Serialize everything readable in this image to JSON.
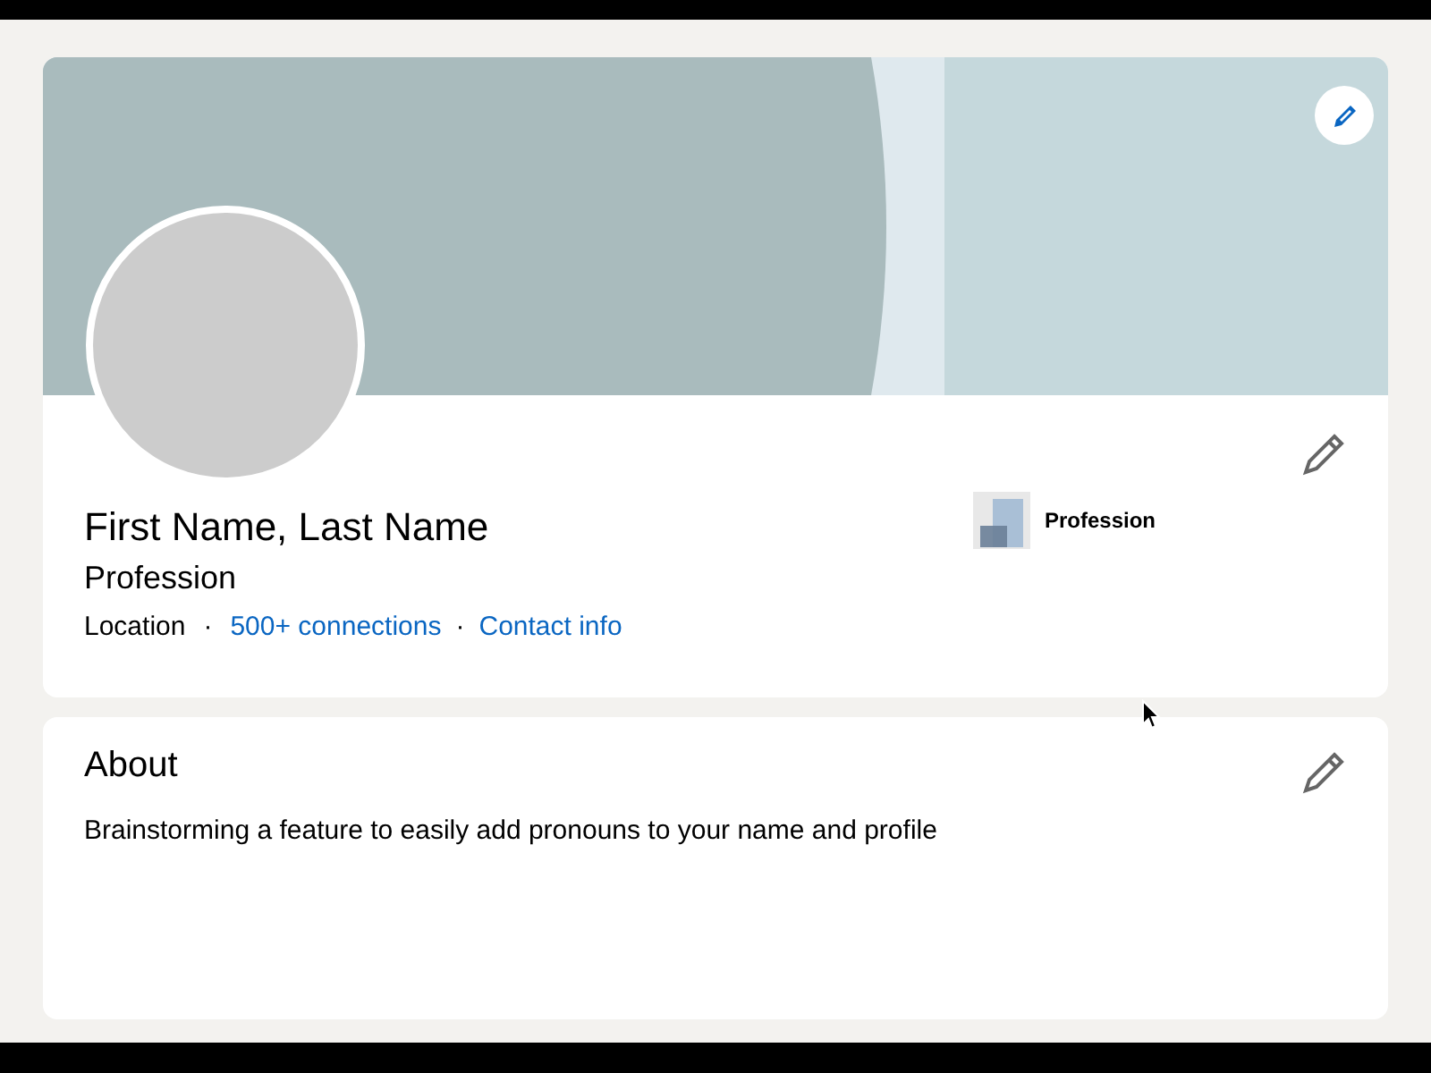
{
  "profile": {
    "name": "First Name, Last Name",
    "headline": "Profession",
    "location": "Location",
    "separator_1": "·",
    "connections": "500+ connections",
    "separator_2": "·",
    "contact": "Contact info",
    "current_position": "Profession"
  },
  "about": {
    "title": "About",
    "text": "Brainstorming a feature to easily add pronouns to your name and profile"
  }
}
